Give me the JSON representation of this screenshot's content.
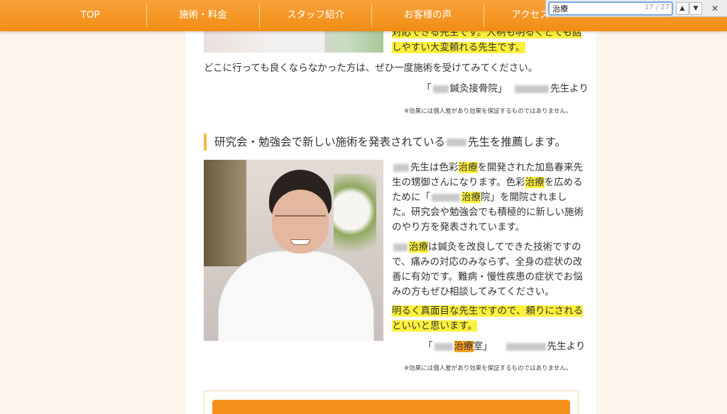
{
  "nav": {
    "items": [
      {
        "label": "TOP"
      },
      {
        "label": "施術・料金"
      },
      {
        "label": "スタッフ紹介"
      },
      {
        "label": "お客様の声"
      },
      {
        "label": "アクセス"
      }
    ]
  },
  "findbar": {
    "query": "治療",
    "count": "17 / 27",
    "prev_icon": "chevron-up-icon",
    "next_icon": "chevron-down-icon",
    "close_icon": "close-icon"
  },
  "review1": {
    "line_a": "対応できる先生です。人柄も明るくとても話",
    "line_b": "しやすい大変頼れる先生です。",
    "recommend": "どこに行っても良くならなかった方は、ぜひ一度施術を受けてみてください。",
    "clinic": "鍼灸接骨院」",
    "teacher_suffix": "先生より",
    "note": "※効果には個人差があり効果を保証するものではありません。"
  },
  "review2": {
    "heading_a": "研究会・勉強会で新しい施術を発表されている",
    "heading_b": "先生を推薦します。",
    "p1": [
      {
        "pre": "",
        "mid": "先生は色彩",
        "hl": "治療",
        "post": "を開発された加島春来先"
      },
      {
        "pre": "",
        "mid": "生の甥御さんになります。色彩",
        "hl": "治療",
        "post": "を広める"
      },
      {
        "pre": "ために「",
        "mid": "",
        "hl": "治療",
        "post": "院」を開院されまし"
      },
      {
        "pre": "",
        "mid": "た。研究会や勉強会でも積極的に新しい施術",
        "hl": "",
        "post": ""
      },
      {
        "pre": "",
        "mid": "のやり方を発表されています。",
        "hl": "",
        "post": ""
      }
    ],
    "p2": [
      {
        "hl": "治療",
        "post": "は鍼灸を改良してできた技術ですの"
      },
      {
        "hl": "",
        "post": "で、痛みの対応のみならず、全身の症状の改"
      },
      {
        "hl": "",
        "post": "善に有効です。難病・慢性疾患の症状でお悩"
      },
      {
        "hl": "",
        "post": "みの方もぜひ相談してみてください。"
      }
    ],
    "p3_a": "明るく真面目な先生ですので、頼りにされる",
    "p3_b": "といいと思います。",
    "sig_open": "「",
    "sig_hl": "治療",
    "sig_room": "室」",
    "teacher_suffix": "先生より",
    "note": "※効果には個人差があり効果を保証するものではありません。"
  },
  "colors": {
    "nav": "#f18d14",
    "highlight": "#fff13b",
    "current_highlight": "#f7a21e",
    "heading_bar": "#f7b94a",
    "page_bg": "#fdf4ec"
  }
}
